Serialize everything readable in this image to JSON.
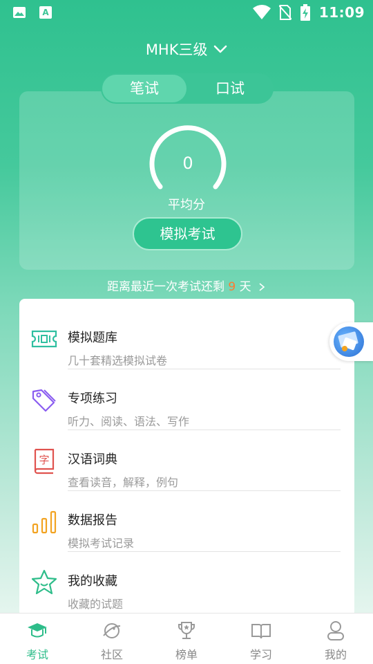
{
  "statusbar": {
    "time": "11:09",
    "icons": [
      "image-icon",
      "font-icon",
      "wifi-icon",
      "no-sim-icon",
      "battery-charging-icon"
    ]
  },
  "header": {
    "level_selector": "MHK三级",
    "tabs": [
      {
        "label": "笔试",
        "active": true
      },
      {
        "label": "口试",
        "active": false
      }
    ]
  },
  "score": {
    "value": "0",
    "label": "平均分",
    "mock_button": "模拟考试"
  },
  "countdown": {
    "prefix": "距离最近一次考试还剩",
    "days": "9",
    "suffix": "天"
  },
  "menu": {
    "items": [
      {
        "title": "模拟题库",
        "subtitle": "几十套精选模拟试卷",
        "icon": "ticket-icon",
        "color": "#2fbfa0"
      },
      {
        "title": "专项练习",
        "subtitle": "听力、阅读、语法、写作",
        "icon": "tag-icon",
        "color": "#8a5cf0"
      },
      {
        "title": "汉语词典",
        "subtitle": "查看读音，解释，例句",
        "icon": "dictionary-icon",
        "color": "#e0524e",
        "glyph": "字"
      },
      {
        "title": "数据报告",
        "subtitle": "模拟考试记录",
        "icon": "bar-chart-icon",
        "color": "#f2a321"
      },
      {
        "title": "我的收藏",
        "subtitle": "收藏的试题",
        "icon": "star-icon",
        "color": "#2ebd8a"
      }
    ]
  },
  "bottom_nav": {
    "items": [
      {
        "label": "考试",
        "icon": "graduation-cap-icon",
        "active": true
      },
      {
        "label": "社区",
        "icon": "planet-icon",
        "active": false
      },
      {
        "label": "榜单",
        "icon": "trophy-icon",
        "active": false
      },
      {
        "label": "学习",
        "icon": "book-icon",
        "active": false
      },
      {
        "label": "我的",
        "icon": "profile-icon",
        "active": false
      }
    ]
  },
  "colors": {
    "brand": "#2fc18f",
    "accent_orange": "#ff7a2f",
    "nav_active": "#2ebd8a"
  }
}
